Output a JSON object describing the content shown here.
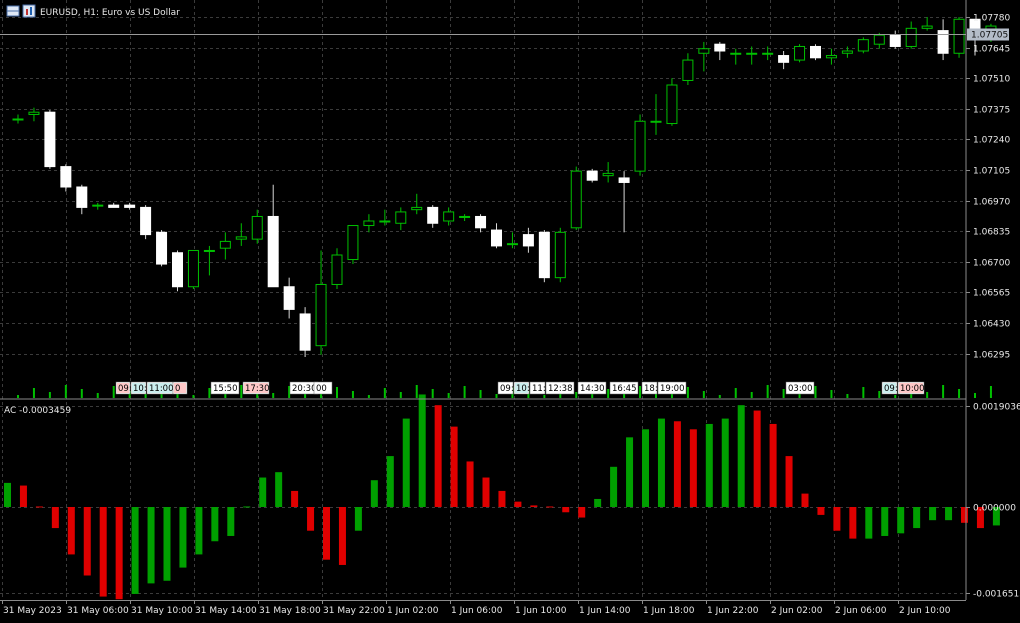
{
  "header": {
    "title": "EURUSD, H1:  Euro vs US Dollar",
    "indicator_label": "AC -0.0003459"
  },
  "colors": {
    "background": "#000000",
    "grid": "#3b3b3b",
    "bull_candle": "#00c000",
    "bear_candle": "#ffffff",
    "ac_up": "#00a000",
    "ac_down": "#e00000",
    "axis_text": "#e8e8e8",
    "price_marker_bg": "#b4bcc8"
  },
  "price_axis": {
    "labels": [
      "1.07780",
      "1.07645",
      "1.07510",
      "1.07375",
      "1.07240",
      "1.07105",
      "1.06970",
      "1.06835",
      "1.06700",
      "1.06565",
      "1.06430",
      "1.06295"
    ],
    "current": "1.07705"
  },
  "indicator_axis": {
    "labels": [
      "0.0019036",
      "0.000000",
      "-0.0016513"
    ]
  },
  "time_axis": {
    "labels": [
      "31 May 2023",
      "31 May 06:00",
      "31 May 10:00",
      "31 May 14:00",
      "31 May 18:00",
      "31 May 22:00",
      "1 Jun 02:00",
      "1 Jun 06:00",
      "1 Jun 10:00",
      "1 Jun 14:00",
      "1 Jun 18:00",
      "1 Jun 22:00",
      "2 Jun 02:00",
      "2 Jun 06:00",
      "2 Jun 10:00"
    ]
  },
  "event_labels": [
    {
      "text": "09:",
      "color": "#ff9a9a"
    },
    {
      "text": "10:",
      "color": "#a0e0e0"
    },
    {
      "text": "11:00",
      "color": "#a0e0e0"
    },
    {
      "text": "0",
      "color": "#ff9a9a"
    },
    {
      "text": "15:50",
      "color": "#ffffff"
    },
    {
      "text": "17:30",
      "color": "#ff9a9a"
    },
    {
      "text": "20:30",
      "color": "#ffffff"
    },
    {
      "text": "00",
      "color": "#ffffff"
    },
    {
      "text": "09:",
      "color": "#ffffff"
    },
    {
      "text": "10:",
      "color": "#a0e0e0"
    },
    {
      "text": "11:",
      "color": "#ffffff"
    },
    {
      "text": "12:38",
      "color": "#ffffff"
    },
    {
      "text": "14:30",
      "color": "#ffffff"
    },
    {
      "text": "16:45",
      "color": "#ffffff"
    },
    {
      "text": "18:",
      "color": "#ffffff"
    },
    {
      "text": "19:00",
      "color": "#ffffff"
    },
    {
      "text": "03:00",
      "color": "#ffffff"
    },
    {
      "text": "09:",
      "color": "#a0e0e0"
    },
    {
      "text": "10:00",
      "color": "#ff9a9a"
    }
  ],
  "chart_data": [
    {
      "type": "candlestick",
      "title": "EURUSD, H1:  Euro vs US Dollar",
      "ylim": [
        1.0623,
        1.0781
      ],
      "columns": [
        "open",
        "high",
        "low",
        "close"
      ],
      "candles": [
        [
          1.0733,
          1.0735,
          1.0731,
          1.0733
        ],
        [
          1.0735,
          1.0738,
          1.0732,
          1.0736
        ],
        [
          1.0736,
          1.0737,
          1.0711,
          1.0712
        ],
        [
          1.0712,
          1.0713,
          1.0701,
          1.0703
        ],
        [
          1.0703,
          1.0704,
          1.0691,
          1.0694
        ],
        [
          1.0695,
          1.0696,
          1.0693,
          1.0695
        ],
        [
          1.0695,
          1.0696,
          1.0694,
          1.0694
        ],
        [
          1.0695,
          1.0696,
          1.0693,
          1.0694
        ],
        [
          1.0694,
          1.0695,
          1.068,
          1.0682
        ],
        [
          1.0683,
          1.0684,
          1.0668,
          1.0669
        ],
        [
          1.0674,
          1.0675,
          1.0657,
          1.0659
        ],
        [
          1.0659,
          1.0675,
          1.0658,
          1.0675
        ],
        [
          1.0675,
          1.0677,
          1.0664,
          1.0675
        ],
        [
          1.0676,
          1.0683,
          1.0671,
          1.0679
        ],
        [
          1.068,
          1.0687,
          1.0677,
          1.0681
        ],
        [
          1.068,
          1.0693,
          1.0678,
          1.069
        ],
        [
          1.069,
          1.0704,
          1.0673,
          1.0659
        ],
        [
          1.0659,
          1.0663,
          1.0645,
          1.0649
        ],
        [
          1.0647,
          1.065,
          1.0628,
          1.0631
        ],
        [
          1.0633,
          1.0675,
          1.0629,
          1.066
        ],
        [
          1.066,
          1.0676,
          1.0658,
          1.0673
        ],
        [
          1.0671,
          1.0686,
          1.0669,
          1.0686
        ],
        [
          1.0686,
          1.0691,
          1.0683,
          1.0688
        ],
        [
          1.0688,
          1.0693,
          1.0686,
          1.0688
        ],
        [
          1.0687,
          1.0694,
          1.0684,
          1.0692
        ],
        [
          1.0693,
          1.07,
          1.0691,
          1.0694
        ],
        [
          1.0694,
          1.0695,
          1.0685,
          1.0687
        ],
        [
          1.0688,
          1.0694,
          1.0686,
          1.0692
        ],
        [
          1.069,
          1.0691,
          1.0688,
          1.069
        ],
        [
          1.069,
          1.0691,
          1.0683,
          1.0685
        ],
        [
          1.0684,
          1.0687,
          1.0676,
          1.0677
        ],
        [
          1.0678,
          1.0683,
          1.0676,
          1.0678
        ],
        [
          1.0682,
          1.0685,
          1.0674,
          1.0677
        ],
        [
          1.0683,
          1.0684,
          1.0661,
          1.0663
        ],
        [
          1.0663,
          1.0685,
          1.0661,
          1.0683
        ],
        [
          1.0685,
          1.0712,
          1.0684,
          1.071
        ],
        [
          1.071,
          1.0711,
          1.0705,
          1.0706
        ],
        [
          1.0708,
          1.0714,
          1.0705,
          1.0709
        ],
        [
          1.0707,
          1.071,
          1.0683,
          1.0705
        ],
        [
          1.071,
          1.0735,
          1.0708,
          1.0732
        ],
        [
          1.0732,
          1.0744,
          1.0726,
          1.0732
        ],
        [
          1.0731,
          1.0751,
          1.073,
          1.0748
        ],
        [
          1.075,
          1.0762,
          1.0748,
          1.0759
        ],
        [
          1.0762,
          1.0767,
          1.0754,
          1.0764
        ],
        [
          1.0766,
          1.0767,
          1.0759,
          1.0763
        ],
        [
          1.0762,
          1.0764,
          1.0757,
          1.0762
        ],
        [
          1.0762,
          1.0765,
          1.0757,
          1.0762
        ],
        [
          1.0762,
          1.0765,
          1.0759,
          1.0762
        ],
        [
          1.0761,
          1.0763,
          1.0755,
          1.0758
        ],
        [
          1.0759,
          1.0766,
          1.0758,
          1.0765
        ],
        [
          1.0765,
          1.0766,
          1.0759,
          1.076
        ],
        [
          1.076,
          1.0764,
          1.0757,
          1.0761
        ],
        [
          1.0762,
          1.0765,
          1.076,
          1.0763
        ],
        [
          1.0763,
          1.0769,
          1.0762,
          1.0768
        ],
        [
          1.0766,
          1.0771,
          1.0764,
          1.077
        ],
        [
          1.077,
          1.0772,
          1.0764,
          1.0765
        ],
        [
          1.0765,
          1.0776,
          1.0764,
          1.0773
        ],
        [
          1.0773,
          1.0778,
          1.0772,
          1.0774
        ],
        [
          1.0772,
          1.0777,
          1.0759,
          1.0762
        ],
        [
          1.0762,
          1.0778,
          1.076,
          1.0777
        ],
        [
          1.0777,
          1.0777,
          1.0761,
          1.0768
        ],
        [
          1.0769,
          1.0775,
          1.0767,
          1.0774
        ]
      ]
    },
    {
      "type": "bar",
      "title": "AC -0.0003459",
      "ylim": [
        -0.0016513,
        0.0019036
      ],
      "series": [
        {
          "values": [
            0.00045,
            0.0004,
            1e-05,
            -0.0004,
            -0.0009,
            -0.0013,
            -0.0017,
            -0.00175,
            -0.00165,
            -0.00145,
            -0.0014,
            -0.00115,
            -0.0009,
            -0.00065,
            -0.00055,
            1e-05,
            0.00055,
            0.00065,
            0.0003,
            -0.00045,
            -0.001,
            -0.0011,
            -0.00045,
            0.0005,
            0.00095,
            0.00165,
            0.0021,
            0.0019,
            0.0015,
            0.00085,
            0.00055,
            0.0003,
            0.0001,
            3e-05,
            1e-05,
            -0.0001,
            -0.0002,
            0.00015,
            0.00075,
            0.0013,
            0.00145,
            0.00165,
            0.0016,
            0.00145,
            0.00155,
            0.00165,
            0.0019,
            0.0018,
            0.00155,
            0.00095,
            0.00025,
            -0.00015,
            -0.00045,
            -0.0006,
            -0.0006,
            -0.00055,
            -0.0005,
            -0.0004,
            -0.00025,
            -0.00025,
            -0.0003,
            -0.0004,
            -0.00035
          ]
        }
      ]
    }
  ]
}
